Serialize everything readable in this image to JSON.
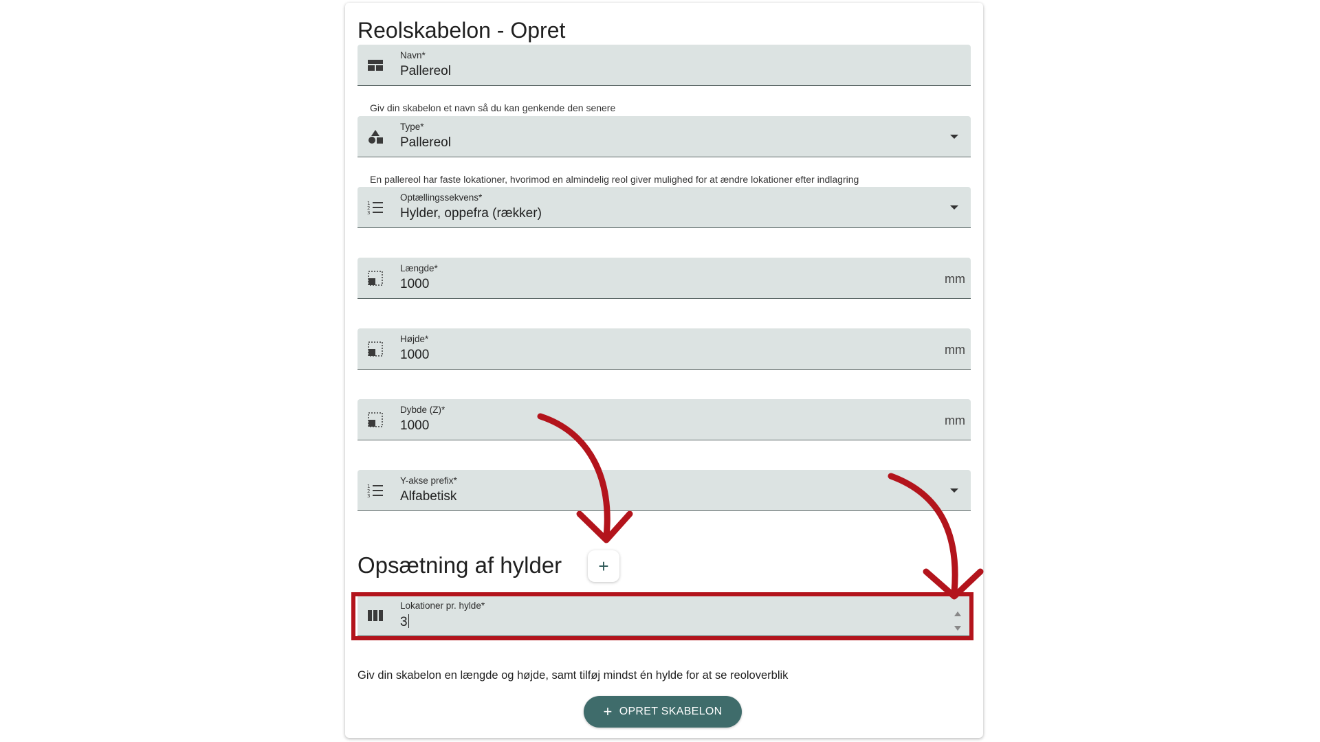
{
  "page": {
    "title": "Reolskabelon - Opret"
  },
  "fields": {
    "navn": {
      "label": "Navn*",
      "value": "Pallereol",
      "hint": "Giv din skabelon et navn så du kan genkende den senere"
    },
    "type": {
      "label": "Type*",
      "value": "Pallereol",
      "hint": "En pallereol har faste lokationer, hvorimod en almindelig reol giver mulighed for at ændre lokationer efter indlagring"
    },
    "sekvens": {
      "label": "Optællingssekvens*",
      "value": "Hylder, oppefra (rækker)"
    },
    "laengde": {
      "label": "Længde*",
      "value": "1000",
      "suffix": "mm"
    },
    "hojde": {
      "label": "Højde*",
      "value": "1000",
      "suffix": "mm"
    },
    "dybde": {
      "label": "Dybde (Z)*",
      "value": "1000",
      "suffix": "mm"
    },
    "yakse": {
      "label": "Y-akse prefix*",
      "value": "Alfabetisk"
    }
  },
  "shelves": {
    "title": "Opsætning af hylder",
    "add_label": "+",
    "lokationer": {
      "label": "Lokationer pr. hylde*",
      "value": "3"
    }
  },
  "info_text": "Giv din skabelon en længde og højde, samt tilføj mindst én hylde for at se reoloverblik",
  "create_button": {
    "label": "OPRET SKABELON",
    "icon": "+"
  },
  "colors": {
    "field_bg": "#dce3e2",
    "primary": "#3f6c6b",
    "annotation": "#b3141c"
  }
}
